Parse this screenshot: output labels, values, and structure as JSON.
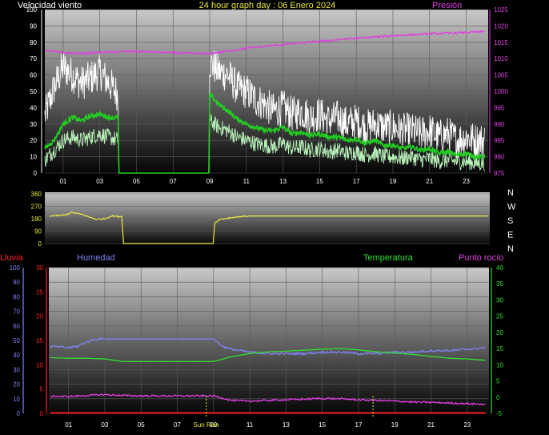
{
  "header": {
    "left_title": "Velocidad viento",
    "center_title": "24 hour graph day : 06 Enero 2024",
    "right_title": "Presión"
  },
  "colors": {
    "wind_gust": "#ffffff",
    "wind_avg_light": "#b8f0b8",
    "wind_avg": "#22cc22",
    "pressure": "#e040e0",
    "direction": "#e8e840",
    "humidity": "#8080f0",
    "temperature": "#30e030",
    "dewpoint": "#e040e0",
    "rain": "#ff2020",
    "sunrise": "#e8e840",
    "left_axis_wind": "#ffffff",
    "right_axis_pressure": "#e040e0",
    "axis_lluvia": "#ff2020",
    "axis_humedad": "#8080f0",
    "axis_temperatura": "#30e030",
    "hour_ticks": "#e8e840"
  },
  "chart_data": [
    {
      "id": "wind",
      "type": "line",
      "title": "24 hour graph day : 06 Enero 2024",
      "ylabel": "Velocidad viento",
      "y2label": "Presión",
      "ylim": [
        0,
        100
      ],
      "y_ticks": [
        0,
        10,
        20,
        30,
        40,
        50,
        60,
        70,
        80,
        90,
        100
      ],
      "y2lim": [
        975,
        1025
      ],
      "y2_ticks": [
        975,
        980,
        985,
        990,
        995,
        1000,
        1005,
        1010,
        1015,
        1020,
        1025
      ],
      "x_ticks": [
        "01",
        "03",
        "05",
        "07",
        "09",
        "11",
        "13",
        "15",
        "17",
        "19",
        "21",
        "23"
      ],
      "series": [
        {
          "role": "gust",
          "x": [
            0,
            0.5,
            1,
            1.5,
            2,
            2.5,
            3,
            3.5,
            4,
            4.05,
            8.95,
            9,
            9.5,
            10,
            10.5,
            11,
            11.5,
            12,
            12.5,
            13,
            13.5,
            14,
            14.5,
            15,
            15.5,
            16,
            16.5,
            17,
            17.5,
            18,
            18.5,
            19,
            19.5,
            20,
            20.5,
            21,
            21.5,
            22,
            22.5,
            23,
            23.5,
            24
          ],
          "values": [
            35,
            52,
            65,
            60,
            55,
            58,
            62,
            55,
            48,
            0,
            0,
            68,
            62,
            60,
            52,
            50,
            45,
            42,
            38,
            40,
            36,
            38,
            34,
            36,
            32,
            34,
            30,
            32,
            28,
            30,
            28,
            28,
            26,
            26,
            24,
            26,
            22,
            24,
            20,
            22,
            20,
            20
          ]
        },
        {
          "role": "avg",
          "x": [
            0,
            0.5,
            1,
            1.5,
            2,
            2.5,
            3,
            3.5,
            4,
            4.05,
            8.95,
            9,
            9.5,
            10,
            10.5,
            11,
            11.5,
            12,
            12.5,
            13,
            13.5,
            14,
            14.5,
            15,
            15.5,
            16,
            16.5,
            17,
            17.5,
            18,
            18.5,
            19,
            19.5,
            20,
            20.5,
            21,
            21.5,
            22,
            22.5,
            23,
            23.5,
            24
          ],
          "values": [
            15,
            20,
            30,
            34,
            32,
            35,
            36,
            34,
            34,
            0,
            0,
            48,
            42,
            38,
            33,
            30,
            28,
            26,
            26,
            28,
            24,
            25,
            23,
            24,
            22,
            22,
            20,
            21,
            18,
            20,
            17,
            17,
            15,
            16,
            14,
            15,
            12,
            13,
            11,
            12,
            10,
            10
          ]
        },
        {
          "role": "avg_light",
          "x": [
            0,
            0.5,
            1,
            1.5,
            2,
            2.5,
            3,
            3.5,
            4,
            4.05,
            8.95,
            9,
            9.5,
            10,
            10.5,
            11,
            11.5,
            12,
            12.5,
            13,
            13.5,
            14,
            14.5,
            15,
            15.5,
            16,
            16.5,
            17,
            17.5,
            18,
            18.5,
            19,
            19.5,
            20,
            20.5,
            21,
            21.5,
            22,
            22.5,
            23,
            23.5,
            24
          ],
          "values": [
            8,
            14,
            20,
            22,
            20,
            22,
            24,
            22,
            20,
            0,
            0,
            32,
            28,
            26,
            22,
            20,
            18,
            17,
            16,
            18,
            15,
            16,
            14,
            15,
            13,
            14,
            12,
            13,
            11,
            12,
            10,
            10,
            9,
            10,
            8,
            9,
            7,
            8,
            7,
            7,
            6,
            6
          ]
        },
        {
          "role": "pressure",
          "x": [
            0,
            1,
            2,
            3,
            4,
            5,
            6,
            7,
            8,
            9,
            10,
            11,
            12,
            13,
            14,
            15,
            16,
            17,
            18,
            19,
            20,
            21,
            22,
            23,
            24
          ],
          "values": [
            1012.5,
            1011.8,
            1011.6,
            1011.9,
            1012.1,
            1012.2,
            1012.0,
            1011.8,
            1011.6,
            1011.5,
            1012.3,
            1013.2,
            1013.8,
            1014.3,
            1014.8,
            1015.3,
            1015.8,
            1016.2,
            1016.6,
            1017.0,
            1017.3,
            1017.6,
            1017.8,
            1018.0,
            1018.2
          ]
        }
      ]
    },
    {
      "id": "direction",
      "type": "line",
      "ylim": [
        0,
        360
      ],
      "y_ticks": [
        0,
        90,
        180,
        270,
        360
      ],
      "right_labels": [
        "N",
        "W",
        "S",
        "E",
        "N"
      ],
      "series": [
        {
          "role": "direction",
          "x": [
            0,
            0.8,
            1.2,
            1.8,
            2.2,
            2.6,
            3.0,
            3.4,
            3.8,
            3.95,
            4.05,
            8.95,
            9.05,
            9.3,
            9.8,
            10.4,
            11.0,
            12,
            14,
            16,
            18,
            20,
            22,
            24
          ],
          "values": [
            200,
            205,
            225,
            210,
            190,
            175,
            180,
            200,
            195,
            200,
            0,
            0,
            150,
            175,
            185,
            195,
            200,
            200,
            200,
            200,
            200,
            200,
            200,
            200
          ]
        }
      ]
    },
    {
      "id": "temp",
      "type": "line",
      "left_labels": {
        "lluvia": "Lluvia",
        "humedad": "Humedad"
      },
      "right_labels": {
        "temperatura": "Temperatura",
        "punto_rocio": "Punto rocío"
      },
      "lluvia_ticks": [
        0,
        5,
        10,
        15,
        20,
        25,
        30
      ],
      "humedad_ticks": [
        0,
        10,
        20,
        30,
        40,
        50,
        60,
        70,
        80,
        90,
        100
      ],
      "temp_lim": [
        -5,
        40
      ],
      "temp_ticks": [
        -5,
        0,
        5,
        10,
        15,
        20,
        25,
        30,
        35,
        40
      ],
      "x_ticks": [
        "01",
        "03",
        "05",
        "07",
        "09",
        "11",
        "13",
        "15",
        "17",
        "19",
        "21",
        "23"
      ],
      "sunrise_label": "Sun Rise",
      "sunrise_x": 8.6,
      "sunset_x": 17.8,
      "series": [
        {
          "role": "humidity",
          "x": [
            0,
            1,
            1.5,
            2,
            2.5,
            3,
            4,
            5,
            6,
            7,
            8,
            9,
            9.5,
            10,
            11,
            12,
            13,
            14,
            15,
            16,
            17,
            18,
            19,
            20,
            21,
            22,
            23,
            24
          ],
          "values": [
            46,
            45,
            46,
            49,
            51,
            51,
            51,
            51,
            51,
            51,
            51,
            51,
            46,
            44,
            42,
            41,
            41,
            41,
            42,
            42,
            41,
            41,
            42,
            42,
            43,
            43,
            44,
            45
          ]
        },
        {
          "role": "temperature",
          "x": [
            0,
            1,
            2,
            3,
            4,
            5,
            6,
            7,
            8,
            9,
            10,
            11,
            12,
            13,
            14,
            15,
            16,
            17,
            18,
            19,
            20,
            21,
            22,
            23,
            24
          ],
          "values": [
            12.2,
            12.0,
            12.0,
            11.8,
            11.0,
            11.0,
            11.0,
            11.0,
            11.0,
            11.0,
            12.5,
            13.5,
            14.0,
            14.2,
            14.5,
            14.8,
            15.0,
            14.6,
            14.0,
            13.6,
            13.2,
            12.6,
            12.0,
            11.8,
            11.4
          ]
        },
        {
          "role": "dewpoint",
          "x": [
            0,
            1,
            2,
            3,
            4,
            5,
            6,
            7,
            8,
            9,
            10,
            11,
            12,
            13,
            14,
            15,
            16,
            17,
            18,
            19,
            20,
            21,
            22,
            23,
            24
          ],
          "values": [
            0.3,
            0.2,
            0.5,
            0.8,
            0.5,
            0.4,
            0.4,
            0.4,
            0.4,
            0.4,
            -1.0,
            -1.2,
            -1.0,
            -0.8,
            -0.6,
            -0.4,
            -0.5,
            -0.8,
            -1.0,
            -1.2,
            -1.5,
            -1.6,
            -1.8,
            -2.0,
            -2.2
          ]
        },
        {
          "role": "rain",
          "x": [
            0,
            24
          ],
          "values": [
            0,
            0
          ]
        }
      ]
    }
  ]
}
